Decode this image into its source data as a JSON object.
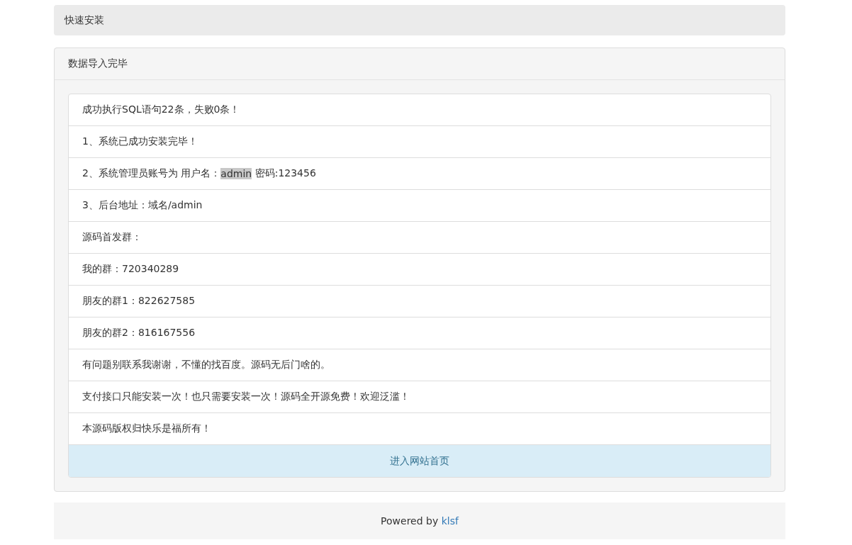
{
  "top_bar": {
    "title": "快速安装"
  },
  "panel": {
    "heading": "数据导入完毕",
    "items": [
      {
        "parts": [
          {
            "text": "成功执行SQL语句22条，失败0条！",
            "highlighted": false
          }
        ]
      },
      {
        "parts": [
          {
            "text": "1、系统已成功安装完毕！",
            "highlighted": false
          }
        ]
      },
      {
        "parts": [
          {
            "text": "2、系统管理员账号为 用户名：",
            "highlighted": false
          },
          {
            "text": "admin",
            "highlighted": true
          },
          {
            "text": " 密码:123456",
            "highlighted": false
          }
        ]
      },
      {
        "parts": [
          {
            "text": "3、后台地址：域名/admin",
            "highlighted": false
          }
        ]
      },
      {
        "parts": [
          {
            "text": "源码首发群：",
            "highlighted": false
          }
        ]
      },
      {
        "parts": [
          {
            "text": "我的群：720340289",
            "highlighted": false
          }
        ]
      },
      {
        "parts": [
          {
            "text": "朋友的群1：822627585",
            "highlighted": false
          }
        ]
      },
      {
        "parts": [
          {
            "text": "朋友的群2：816167556",
            "highlighted": false
          }
        ]
      },
      {
        "parts": [
          {
            "text": "有问题别联系我谢谢，不懂的找百度。源码无后门啥的。",
            "highlighted": false
          }
        ]
      },
      {
        "parts": [
          {
            "text": "支付接口只能安装一次！也只需要安装一次！源码全开源免费！欢迎泛滥！",
            "highlighted": false
          }
        ]
      },
      {
        "parts": [
          {
            "text": "本源码版权归快乐是福所有！",
            "highlighted": false
          }
        ]
      }
    ],
    "action_link": "进入网站首页"
  },
  "footer": {
    "text": "Powered by ",
    "link": "klsf"
  }
}
